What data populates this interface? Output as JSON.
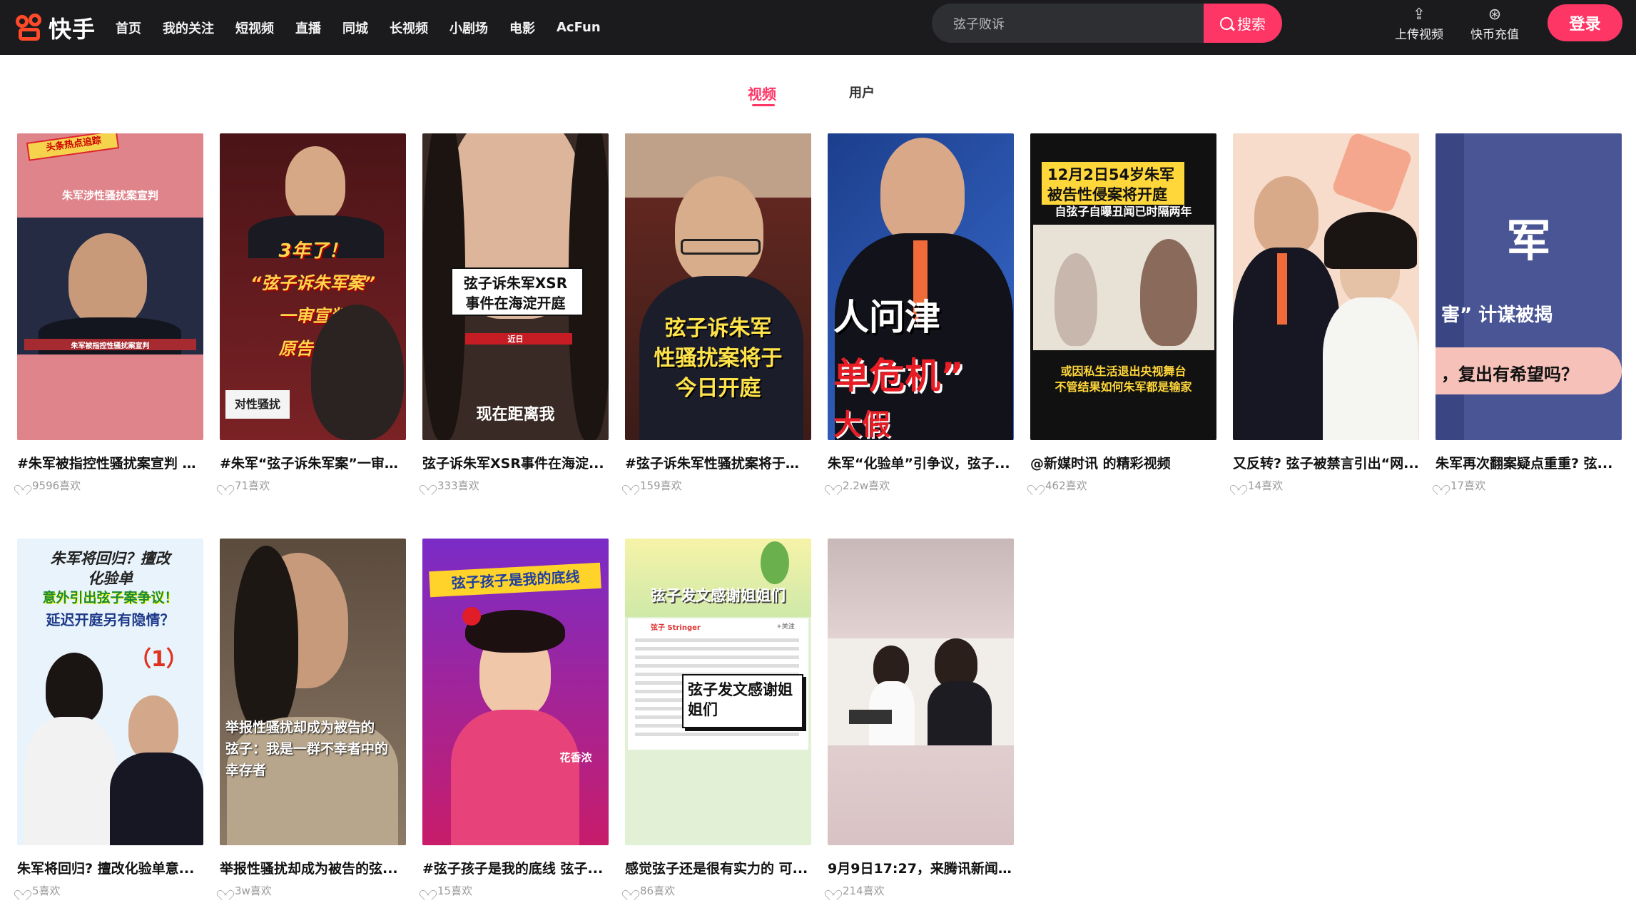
{
  "brand": {
    "name": "快手"
  },
  "nav": [
    "首页",
    "我的关注",
    "短视频",
    "直播",
    "同城",
    "长视频",
    "小剧场",
    "电影",
    "AcFun"
  ],
  "search": {
    "value": "弦子败诉",
    "button": "搜索"
  },
  "actions": {
    "upload": "上传视频",
    "coin": "快币充值",
    "login": "登录"
  },
  "tabs": {
    "videos": "视频",
    "users": "用户"
  },
  "cards": [
    {
      "title": "#朱军被指控性骚扰案宣判 朱...",
      "likes": "9596喜欢",
      "caps": [
        "头条热点追踪",
        "朱军涉性骚扰案宣判",
        "朱军被指控性骚扰案宣判"
      ]
    },
    {
      "title": "#朱军“弦子诉朱军案”一审宣...",
      "likes": "71喜欢",
      "caps": [
        "3年了！",
        "“弦子诉朱军案”",
        "一审宣判",
        "原告败诉",
        "对性骚扰"
      ]
    },
    {
      "title": "弦子诉朱军XSR事件在海淀...",
      "likes": "333喜欢",
      "caps": [
        "弦子诉朱军XSR",
        "事件在海淀开庭",
        "近日",
        "现在距离我"
      ]
    },
    {
      "title": "#弦子诉朱军性骚扰案将于今...",
      "likes": "159喜欢",
      "caps": [
        "弦子诉朱军",
        "性骚扰案将于",
        "今日开庭"
      ]
    },
    {
      "title": "朱军“化验单”引争议，弦子...",
      "likes": "2.2w喜欢",
      "caps": [
        "人问津",
        "单危机”",
        "大假"
      ]
    },
    {
      "title": "@新媒时讯 的精彩视频",
      "likes": "462喜欢",
      "caps": [
        "12月2日54岁朱军",
        "被告性侵案将开庭",
        "自弦子自曝丑闻已时隔两年",
        "或因私生活退出央视舞台",
        "不管结果如何朱军都是输家"
      ]
    },
    {
      "title": "又反转? 弦子被禁言引出“网...",
      "likes": "14喜欢",
      "caps": []
    },
    {
      "title": "朱军再次翻案疑点重重? 弦...",
      "likes": "17喜欢",
      "caps": [
        "军",
        "害” 计谋被揭",
        "，复出有希望吗？"
      ]
    },
    {
      "title": "朱军将回归? 擅改化验单意...",
      "likes": "5喜欢",
      "caps": [
        "朱军将回归？擅改",
        "化验单",
        "意外引出弦子案争议！",
        "延迟开庭另有隐情？",
        "（1）"
      ]
    },
    {
      "title": "举报性骚扰却成为被告的弦...",
      "likes": "3w喜欢",
      "caps": [
        "举报性骚扰却成为被告的",
        "弦子：我是一群不幸者中的",
        "幸存者"
      ]
    },
    {
      "title": "#弦子孩子是我的底线  弦子...",
      "likes": "15喜欢",
      "caps": [
        "弦子孩子是我的底线",
        "花香浓"
      ]
    },
    {
      "title": "感觉弦子还是很有实力的 可...",
      "likes": "86喜欢",
      "caps": [
        "弦子发文感谢姐姐们",
        "弦子发文感谢姐",
        "姐们",
        "弦子 Stringer",
        "+关注"
      ]
    },
    {
      "title": "9月9日17:27，来腾讯新闻“为...",
      "likes": "214喜欢",
      "caps": []
    }
  ]
}
